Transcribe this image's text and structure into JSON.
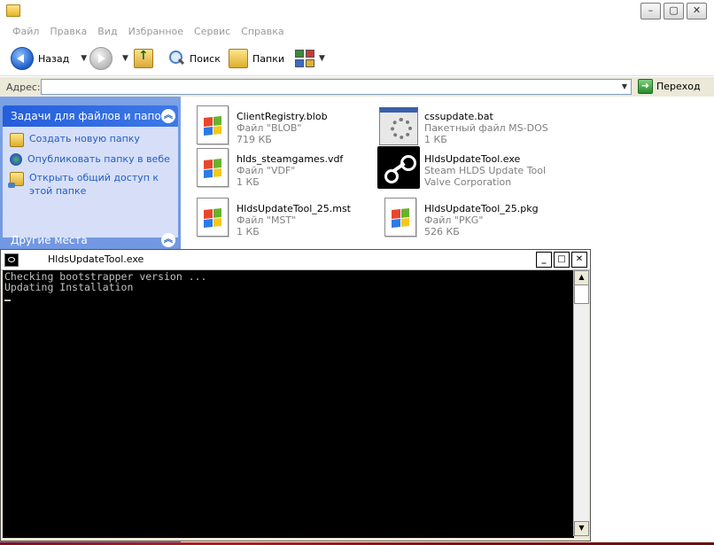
{
  "menu": [
    "Файл",
    "Правка",
    "Вид",
    "Избранное",
    "Сервис",
    "Справка"
  ],
  "toolbar": {
    "back_label": "Назад",
    "search_label": "Поиск",
    "folders_label": "Папки"
  },
  "address": {
    "label": "Адрес:",
    "value": "",
    "go_label": "Переход"
  },
  "tasks": {
    "title": "Задачи для файлов и папок",
    "items": [
      "Создать новую папку",
      "Опубликовать папку в вебе",
      "Открыть общий доступ к этой папке"
    ],
    "other_title": "Другие места"
  },
  "files": [
    {
      "name": "ClientRegistry.blob",
      "line2": "Файл \"BLOB\"",
      "line3": "719 КБ",
      "icon": "windows-doc-icon"
    },
    {
      "name": "cssupdate.bat",
      "line2": "Пакетный файл MS-DOS",
      "line3": "1 КБ",
      "icon": "batch-file-icon"
    },
    {
      "name": "hlds_steamgames.vdf",
      "line2": "Файл \"VDF\"",
      "line3": "1 КБ",
      "icon": "windows-doc-icon"
    },
    {
      "name": "HldsUpdateTool.exe",
      "line2": "Steam HLDS Update Tool",
      "line3": "Valve Corporation",
      "icon": "steam-icon"
    },
    {
      "name": "HldsUpdateTool_25.mst",
      "line2": "Файл \"MST\"",
      "line3": "1 КБ",
      "icon": "windows-doc-icon"
    },
    {
      "name": "HldsUpdateTool_25.pkg",
      "line2": "Файл \"PKG\"",
      "line3": "526 КБ",
      "icon": "windows-doc-icon"
    }
  ],
  "console": {
    "title": "HldsUpdateTool.exe",
    "lines": [
      "Checking bootstrapper version ...",
      "Updating Installation"
    ]
  },
  "colors": {
    "taskpane": "#6a8fdf",
    "task_head": "#245edb",
    "console_bg": "#000000",
    "console_text": "#c0c0c0"
  }
}
